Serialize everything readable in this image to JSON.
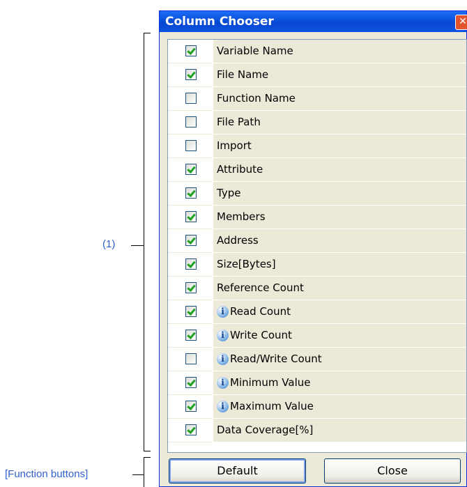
{
  "dialog": {
    "title": "Column Chooser",
    "close_glyph": "✕"
  },
  "annotations": {
    "list_label": "(1)",
    "buttons_label": "[Function buttons]"
  },
  "columns": [
    {
      "label": "Variable Name",
      "checked": true,
      "info": false
    },
    {
      "label": "File Name",
      "checked": true,
      "info": false
    },
    {
      "label": "Function Name",
      "checked": false,
      "info": false
    },
    {
      "label": "File Path",
      "checked": false,
      "info": false
    },
    {
      "label": "Import",
      "checked": false,
      "info": false
    },
    {
      "label": "Attribute",
      "checked": true,
      "info": false
    },
    {
      "label": "Type",
      "checked": true,
      "info": false
    },
    {
      "label": "Members",
      "checked": true,
      "info": false
    },
    {
      "label": "Address",
      "checked": true,
      "info": false
    },
    {
      "label": "Size[Bytes]",
      "checked": true,
      "info": false
    },
    {
      "label": "Reference Count",
      "checked": true,
      "info": false
    },
    {
      "label": "Read Count",
      "checked": true,
      "info": true
    },
    {
      "label": "Write Count",
      "checked": true,
      "info": true
    },
    {
      "label": "Read/Write Count",
      "checked": false,
      "info": true
    },
    {
      "label": "Minimum Value",
      "checked": true,
      "info": true
    },
    {
      "label": "Maximum Value",
      "checked": true,
      "info": true
    },
    {
      "label": "Data Coverage[%]",
      "checked": true,
      "info": false
    }
  ],
  "info_glyph": "i",
  "buttons": {
    "default_label": "Default",
    "close_label": "Close"
  }
}
